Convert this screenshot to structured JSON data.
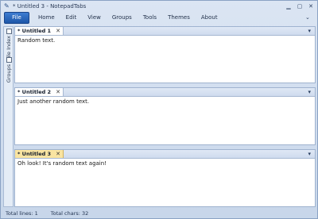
{
  "window": {
    "title": "* Untitled 3 - NotepadTabs",
    "controls": [
      "minimize",
      "maximize",
      "close"
    ]
  },
  "menubar": {
    "file_label": "File",
    "items": [
      "Home",
      "Edit",
      "View",
      "Groups",
      "Tools",
      "Themes",
      "About"
    ]
  },
  "sidebar": {
    "tabs": [
      {
        "label": "File Index",
        "icon": "file-icon"
      },
      {
        "label": "Groups",
        "icon": "groups-icon"
      }
    ]
  },
  "panes": [
    {
      "tab_label": "* Untitled 1",
      "text": "Random text.",
      "active": false
    },
    {
      "tab_label": "* Untitled 2",
      "text": "Just another random text.",
      "active": false
    },
    {
      "tab_label": "* Untitled 3",
      "text": "Oh look! It's random text again!",
      "active": true
    }
  ],
  "status": {
    "lines": "Total lines: 1",
    "chars": "Total chars: 32"
  },
  "colors": {
    "accent": "#1d56a8",
    "active_tab": "#f9e4a1",
    "background": "#c9d7ea"
  }
}
